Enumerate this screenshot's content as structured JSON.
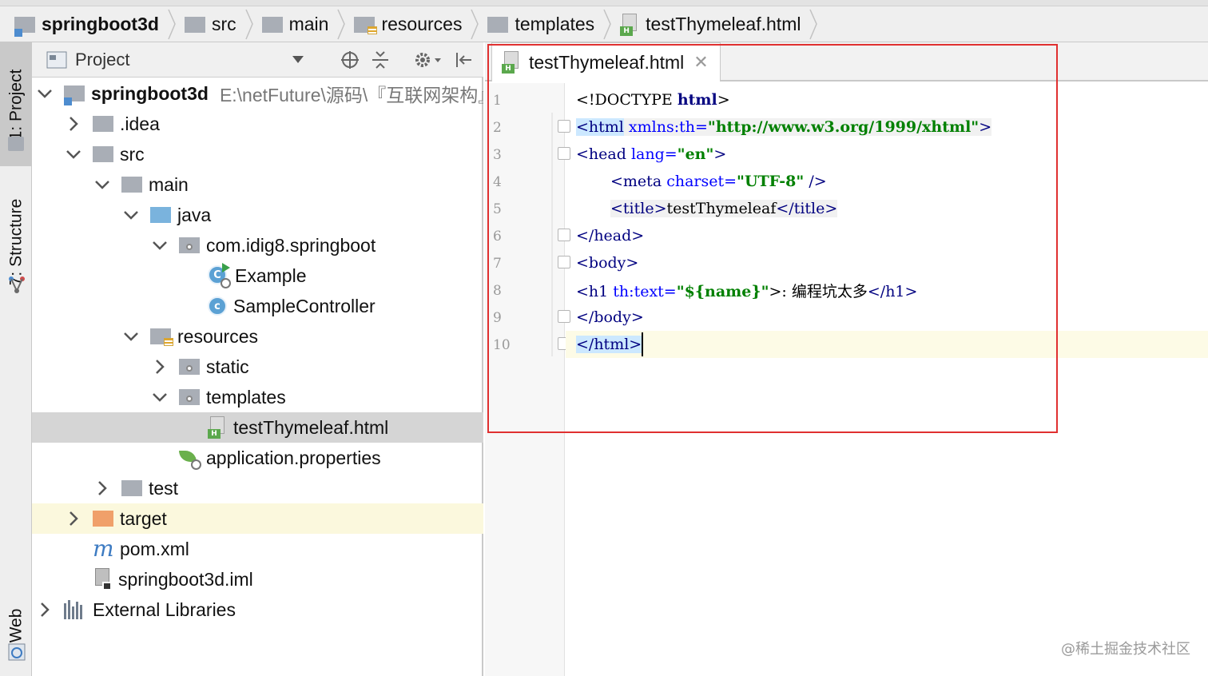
{
  "breadcrumb": {
    "items": [
      {
        "label": "springboot3d",
        "icon": "module-folder-icon",
        "bold": true
      },
      {
        "label": "src",
        "icon": "folder-icon"
      },
      {
        "label": "main",
        "icon": "folder-icon"
      },
      {
        "label": "resources",
        "icon": "resources-folder-icon"
      },
      {
        "label": "templates",
        "icon": "folder-icon"
      },
      {
        "label": "testThymeleaf.html",
        "icon": "html-file-icon"
      }
    ]
  },
  "toolstrip": {
    "project_tab": "1: Project",
    "structure_tab": "7: Structure",
    "web_tab": "Web"
  },
  "project_panel": {
    "title": "Project",
    "tree": [
      {
        "label": "springboot3d",
        "path": "E:\\netFuture\\源码\\『互联网架构』",
        "expanded": true,
        "icon": "module-folder-icon"
      },
      {
        "label": ".idea",
        "expanded": false,
        "icon": "folder-icon"
      },
      {
        "label": "src",
        "expanded": true,
        "icon": "folder-icon"
      },
      {
        "label": "main",
        "expanded": true,
        "icon": "folder-icon"
      },
      {
        "label": "java",
        "expanded": true,
        "icon": "source-folder-icon"
      },
      {
        "label": "com.idig8.springboot",
        "expanded": true,
        "icon": "package-icon"
      },
      {
        "label": "Example",
        "icon": "spring-boot-run-class-icon"
      },
      {
        "label": "SampleController",
        "icon": "class-icon"
      },
      {
        "label": "resources",
        "expanded": true,
        "icon": "resources-folder-icon"
      },
      {
        "label": "static",
        "expanded": false,
        "icon": "folder-icon"
      },
      {
        "label": "templates",
        "expanded": true,
        "icon": "folder-icon"
      },
      {
        "label": "testThymeleaf.html",
        "icon": "html-file-icon",
        "selected": true
      },
      {
        "label": "application.properties",
        "icon": "spring-properties-icon"
      },
      {
        "label": "test",
        "expanded": false,
        "icon": "folder-icon"
      },
      {
        "label": "target",
        "expanded": false,
        "icon": "excluded-folder-icon"
      },
      {
        "label": "pom.xml",
        "icon": "maven-icon"
      },
      {
        "label": "springboot3d.iml",
        "icon": "iml-file-icon"
      },
      {
        "label": "External Libraries",
        "expanded": false,
        "icon": "libraries-icon"
      }
    ]
  },
  "editor": {
    "tab_label": "testThymeleaf.html",
    "line_numbers": [
      "1",
      "2",
      "3",
      "4",
      "5",
      "6",
      "7",
      "8",
      "9",
      "10"
    ],
    "code": {
      "l1": {
        "a": "<!DOCTYPE ",
        "b": "html",
        "c": ">"
      },
      "l2": {
        "a": "<html",
        "b": " xmlns:th=",
        "c": "\"http://www.w3.org/1999/xhtml\"",
        "d": ">"
      },
      "l3": {
        "a": "<head",
        "b": " lang=",
        "c": "\"en\"",
        "d": ">"
      },
      "l4": {
        "a": "<meta",
        "b": " charset=",
        "c": "\"UTF-8\"",
        "d": " />"
      },
      "l5": {
        "a": "<title>",
        "b": "testThymeleaf",
        "c": "</title>"
      },
      "l6": {
        "a": "</head>"
      },
      "l7": {
        "a": "<body>"
      },
      "l8": {
        "a": "<h1",
        "b": " th:text=",
        "c": "\"${name}\"",
        "d": ">: 编程坑太多",
        "e": "</h1>"
      },
      "l9": {
        "a": "</body>"
      },
      "l10": {
        "a": "</html>"
      }
    }
  },
  "watermark": "@稀土掘金技术社区",
  "colors": {
    "highlight_box": "#e03030",
    "selection": "#d5d5d5",
    "current_line": "#fdfbe6"
  }
}
